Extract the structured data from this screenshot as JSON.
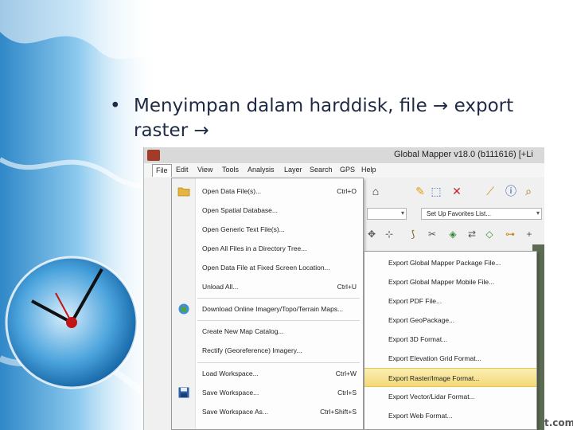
{
  "slide": {
    "bullet_char": "•",
    "bullet_text": "Menyimpan dalam harddisk, file → export raster →"
  },
  "app": {
    "title": "Global Mapper v18.0 (b111616) [+Li",
    "menu": [
      "File",
      "Edit",
      "View",
      "Tools",
      "Analysis",
      "Layer",
      "Search",
      "GPS",
      "Help"
    ],
    "favorites_select": "Set Up Favorites List..."
  },
  "file_menu": {
    "items": [
      {
        "label": "Open Data File(s)...",
        "shortcut": "Ctrl+O"
      },
      {
        "label": "Open Spatial Database...",
        "shortcut": ""
      },
      {
        "label": "Open Generic Text File(s)...",
        "shortcut": ""
      },
      {
        "label": "Open All Files in a Directory Tree...",
        "shortcut": ""
      },
      {
        "label": "Open Data File at Fixed Screen Location...",
        "shortcut": ""
      },
      {
        "label": "Unload All...",
        "shortcut": "Ctrl+U"
      },
      {
        "label": "Download Online Imagery/Topo/Terrain Maps...",
        "shortcut": ""
      },
      {
        "label": "Create New Map Catalog...",
        "shortcut": ""
      },
      {
        "label": "Rectify (Georeference) Imagery...",
        "shortcut": ""
      },
      {
        "label": "Load Workspace...",
        "shortcut": "Ctrl+W"
      },
      {
        "label": "Save Workspace...",
        "shortcut": "Ctrl+S"
      },
      {
        "label": "Save Workspace As...",
        "shortcut": "Ctrl+Shift+S"
      }
    ]
  },
  "export_menu": {
    "items": [
      "Export Global Mapper Package File...",
      "Export Global Mapper Mobile File...",
      "Export PDF File...",
      "Export GeoPackage...",
      "Export 3D Format...",
      "Export Elevation Grid Format...",
      "Export Raster/Image Format...",
      "Export Vector/Lidar Format...",
      "Export Web Format..."
    ],
    "selected_index": 6
  },
  "watermark": "t.com",
  "colors": {
    "highlight": "#f4d978",
    "window_bg": "#f0f0f0",
    "text": "#1f2a44"
  }
}
